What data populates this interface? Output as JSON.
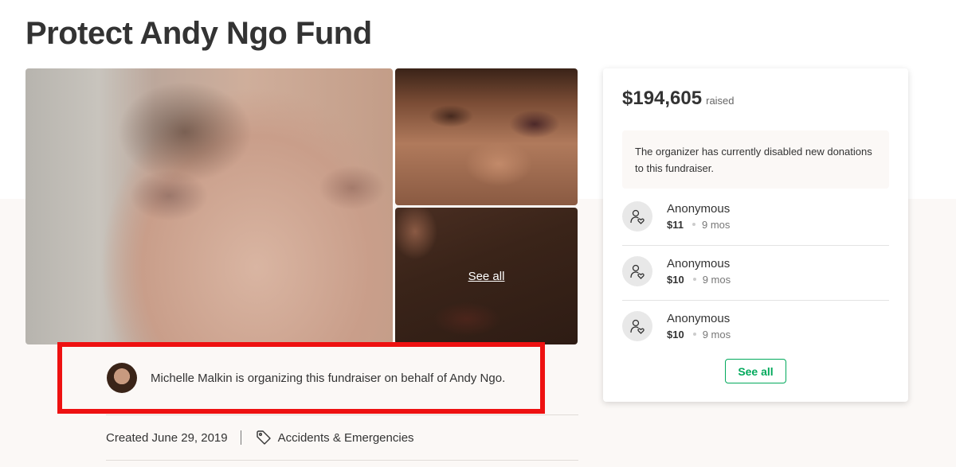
{
  "page": {
    "title": "Protect Andy Ngo Fund"
  },
  "gallery": {
    "see_all_label": "See all"
  },
  "organizer": {
    "text": "Michelle Malkin is organizing this fundraiser on behalf of Andy Ngo."
  },
  "meta": {
    "created": "Created June 29, 2019",
    "category": "Accidents & Emergencies"
  },
  "card": {
    "raised_amount": "$194,605",
    "raised_label": "raised",
    "notice": "The organizer has currently disabled new donations to this fundraiser.",
    "donations": [
      {
        "name": "Anonymous",
        "amount": "$11",
        "time": "9 mos"
      },
      {
        "name": "Anonymous",
        "amount": "$10",
        "time": "9 mos"
      },
      {
        "name": "Anonymous",
        "amount": "$10",
        "time": "9 mos"
      }
    ],
    "see_all_button": "See all"
  },
  "colors": {
    "highlight_frame": "#ee1111",
    "accent_green": "#02a95c",
    "band_background": "#fbf8f6"
  }
}
